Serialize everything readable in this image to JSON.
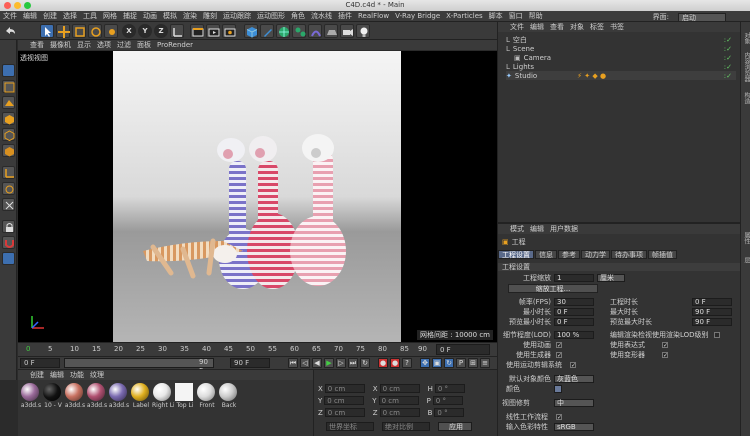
{
  "window": {
    "title": "C4D.c4d * - Main"
  },
  "menubar": {
    "items": [
      "文件",
      "编辑",
      "创建",
      "选择",
      "工具",
      "网格",
      "捕捉",
      "动画",
      "模拟",
      "渲染",
      "雕刻",
      "运动跟踪",
      "运动图形",
      "角色",
      "流水线",
      "插件",
      "RealFlow",
      "V-Ray Bridge",
      "X-Particles",
      "脚本",
      "窗口",
      "帮助"
    ],
    "layout_label": "界面:",
    "layout_value": "启动"
  },
  "toolbar": {
    "icons": [
      "undo-icon",
      "select-icon",
      "move-icon",
      "scale-icon",
      "rotate-icon",
      "recent-icon",
      "x-axis-icon",
      "y-axis-icon",
      "z-axis-icon",
      "coord-icon",
      "render-region-icon",
      "render-view-icon",
      "render-settings-icon",
      "cube-icon",
      "pen-icon",
      "subdivide-icon",
      "cloner-icon",
      "deformer-icon",
      "scene-icon",
      "camera-icon",
      "light-icon"
    ],
    "axis_labels": [
      "X",
      "Y",
      "Z"
    ]
  },
  "viewport": {
    "menu": [
      "查看",
      "摄像机",
      "显示",
      "选项",
      "过滤",
      "面板",
      "ProRender"
    ],
    "view_label": "透视视图",
    "grid_label": "网格间距 : 10000 cm"
  },
  "timeline": {
    "ticks": [
      "0",
      "5",
      "10",
      "15",
      "20",
      "25",
      "30",
      "35",
      "40",
      "45",
      "50",
      "55",
      "60",
      "65",
      "70",
      "75",
      "80",
      "85",
      "90"
    ],
    "current_frame": "0 F"
  },
  "transport": {
    "start": "0 F",
    "start2": "0 F",
    "end": "90 F",
    "end2": "90 F"
  },
  "materials": {
    "menu": [
      "创建",
      "编辑",
      "功能",
      "纹理"
    ],
    "items": [
      {
        "label": "a3dd.s",
        "color": "#9a6a9a"
      },
      {
        "label": "10 - V",
        "color": "#111111"
      },
      {
        "label": "a3dd.s",
        "color": "#c87060"
      },
      {
        "label": "a3dd.s",
        "color": "#b05070"
      },
      {
        "label": "a3dd.s",
        "color": "#7a6ab0"
      },
      {
        "label": "Label",
        "color": "#e0b020"
      },
      {
        "label": "Right Li",
        "color": "#e8e8e8"
      },
      {
        "label": "Top Li",
        "color": "#f4f4f4"
      },
      {
        "label": "Front",
        "color": "#dddddd"
      },
      {
        "label": "Back",
        "color": "#cccccc"
      }
    ]
  },
  "coords": {
    "rows": [
      {
        "a": "X",
        "av": "0 cm",
        "b": "X",
        "bv": "0 cm",
        "c": "H",
        "cv": "0 °"
      },
      {
        "a": "Y",
        "av": "0 cm",
        "b": "Y",
        "bv": "0 cm",
        "c": "P",
        "cv": "0 °"
      },
      {
        "a": "Z",
        "av": "0 cm",
        "b": "Z",
        "bv": "0 cm",
        "c": "B",
        "cv": "0 °"
      }
    ],
    "world_label": "世界坐标",
    "scale_label": "绝对比例",
    "apply_label": "应用"
  },
  "object_manager": {
    "menu": [
      "文件",
      "编辑",
      "查看",
      "对象",
      "标签",
      "书签"
    ],
    "objects": [
      {
        "name": "空白",
        "level": 0
      },
      {
        "name": "Scene",
        "level": 0
      },
      {
        "name": "Camera",
        "level": 1
      },
      {
        "name": "Lights",
        "level": 0
      },
      {
        "name": "Studio",
        "level": 0
      }
    ]
  },
  "attribute_manager": {
    "menu": [
      "模式",
      "编辑",
      "用户数据"
    ],
    "title": "工程",
    "tabs": [
      "工程设置",
      "信息",
      "参考",
      "动力学",
      "待办事项",
      "帧插值"
    ],
    "section": "工程设置",
    "scale_label": "工程缩放",
    "scale_value": "1",
    "scale_unit": "厘米",
    "scale_button": "缩放工程...",
    "fps_label": "帧率(FPS)",
    "fps_value": "30",
    "duration_label": "工程时长",
    "duration_value": "0 F",
    "min_label": "最小时长",
    "min_value": "0 F",
    "max_label": "最大时长",
    "max_value": "90 F",
    "pmin_label": "预览最小时长",
    "pmin_value": "0 F",
    "pmax_label": "预览最大时长",
    "pmax_value": "90 F",
    "lod_label": "细节程度(LOD)",
    "lod_value": "100 %",
    "lod_render_label": "编辑渲染检视使用渲染LOD级别",
    "anim_label": "使用动画",
    "expr_label": "使用表达式",
    "gen_label": "使用生成器",
    "deform_label": "使用变形器",
    "motion_label": "使用运动剪辑系统",
    "objcolor_label": "默认对象颜色",
    "objcolor_value": "灰蓝色",
    "color_label": "颜色",
    "viewclip_label": "视图修剪",
    "viewclip_value": "中",
    "linear_label": "线性工作流程",
    "input_label": "输入色彩特性",
    "input_value": "sRGB"
  },
  "right_tabs": [
    "对象",
    "内容浏览器",
    "构造",
    "属性",
    "层"
  ]
}
